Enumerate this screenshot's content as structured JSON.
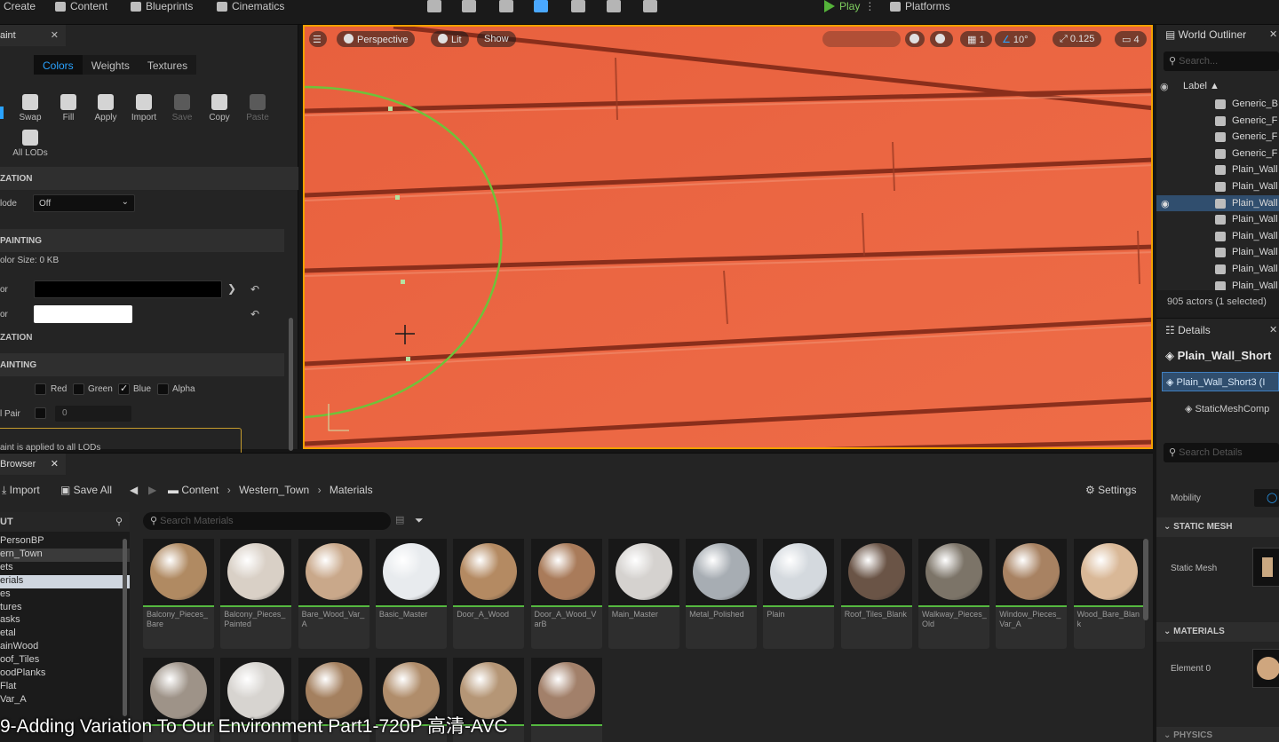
{
  "toolbar": {
    "create": "Create",
    "content": "Content",
    "blueprints": "Blueprints",
    "cinematics": "Cinematics",
    "play": "Play",
    "platforms": "Platforms"
  },
  "mesh_paint": {
    "tab_label": "aint",
    "mode_tabs": [
      "Colors",
      "Weights",
      "Textures"
    ],
    "active_mode": "Colors",
    "tools": [
      "Swap",
      "Fill",
      "Apply",
      "Import",
      "Save",
      "Copy",
      "Paste"
    ],
    "all_lods": "All LODs",
    "sections": {
      "visualization": "ZATION",
      "color_painting": "PAINTING",
      "visualization2": "ZATION",
      "vertex_painting": "AINTING"
    },
    "mode_label": "lode",
    "mode_value": "Off",
    "color_size": "olor Size: 0 KB",
    "paint_color_label": "or",
    "erase_color_label": "or",
    "paint_color_hex": "#000000",
    "erase_color_hex": "#ffffff",
    "channels": [
      "Red",
      "Green",
      "Blue",
      "Alpha"
    ],
    "blue_checked": true,
    "pair_label": "l Pair",
    "pair_value": "0",
    "note": "aint is applied to all LODs"
  },
  "viewport": {
    "perspective": "Perspective",
    "lit": "Lit",
    "show": "Show",
    "grid_value": "1",
    "angle_value": "10°",
    "scale_value": "0.125",
    "camera_value": "4"
  },
  "outliner": {
    "title": "World Outliner",
    "search_placeholder": "Search...",
    "column_label": "Label ▲",
    "items": [
      "Generic_B",
      "Generic_F",
      "Generic_F",
      "Generic_F",
      "Plain_Wall",
      "Plain_Wall",
      "Plain_Wall",
      "Plain_Wall",
      "Plain_Wall",
      "Plain_Wall",
      "Plain_Wall",
      "Plain_Wall"
    ],
    "selected_index": 6,
    "status": "905 actors (1 selected)"
  },
  "details": {
    "title": "Details",
    "actor_name": "Plain_Wall_Short",
    "component_root": "Plain_Wall_Short3 (I",
    "component_child": "StaticMeshComp",
    "search_placeholder": "Search Details",
    "mobility_label": "Mobility",
    "section_static_mesh": "STATIC MESH",
    "static_mesh_label": "Static Mesh",
    "section_materials": "MATERIALS",
    "element_label": "Element 0",
    "section_physics": "PHYSICS"
  },
  "content_browser": {
    "tab_label": "Browser",
    "import_label": "Import",
    "save_all_label": "Save All",
    "breadcrumb": [
      "Content",
      "Western_Town",
      "Materials"
    ],
    "settings_label": "Settings",
    "search_placeholder": "Search Materials",
    "tree_header": "UT",
    "tree_items": [
      "PersonBP",
      "ern_Town",
      "ets",
      "erials",
      "es",
      "tures",
      "asks",
      "etal",
      "ainWood",
      "oof_Tiles",
      "oodPlanks",
      "Flat",
      "Var_A"
    ],
    "tree_selected": [
      1,
      3
    ],
    "assets": [
      {
        "name": "Balcony_Pieces_Bare",
        "color": "#b08a62"
      },
      {
        "name": "Balcony_Pieces_Painted",
        "color": "#d9d0c6"
      },
      {
        "name": "Bare_Wood_Var_A",
        "color": "#c9a88a"
      },
      {
        "name": "Basic_Master",
        "color": "#e8ebee"
      },
      {
        "name": "Door_A_Wood",
        "color": "#b48a62"
      },
      {
        "name": "Door_A_Wood_VarB",
        "color": "#a97b5a"
      },
      {
        "name": "Main_Master",
        "color": "#d5d2cf"
      },
      {
        "name": "Metal_Polished",
        "color": "#a7adb3"
      },
      {
        "name": "Plain",
        "color": "#d4d9de"
      },
      {
        "name": "Roof_Tiles_Blank",
        "color": "#6a5446"
      },
      {
        "name": "Walkway_Pieces_Old",
        "color": "#7c7468"
      },
      {
        "name": "Window_Pieces_Var_A",
        "color": "#a88262"
      },
      {
        "name": "Wood_Bare_Blank",
        "color": "#d9b897"
      }
    ],
    "row2_colors": [
      "#9e9388",
      "#d7d4d0",
      "#a4805f",
      "#b08d6b",
      "#b59676",
      "#a2806a"
    ]
  },
  "caption": "9-Adding Variation To Our Environment Part1-720P 高清-AVC"
}
